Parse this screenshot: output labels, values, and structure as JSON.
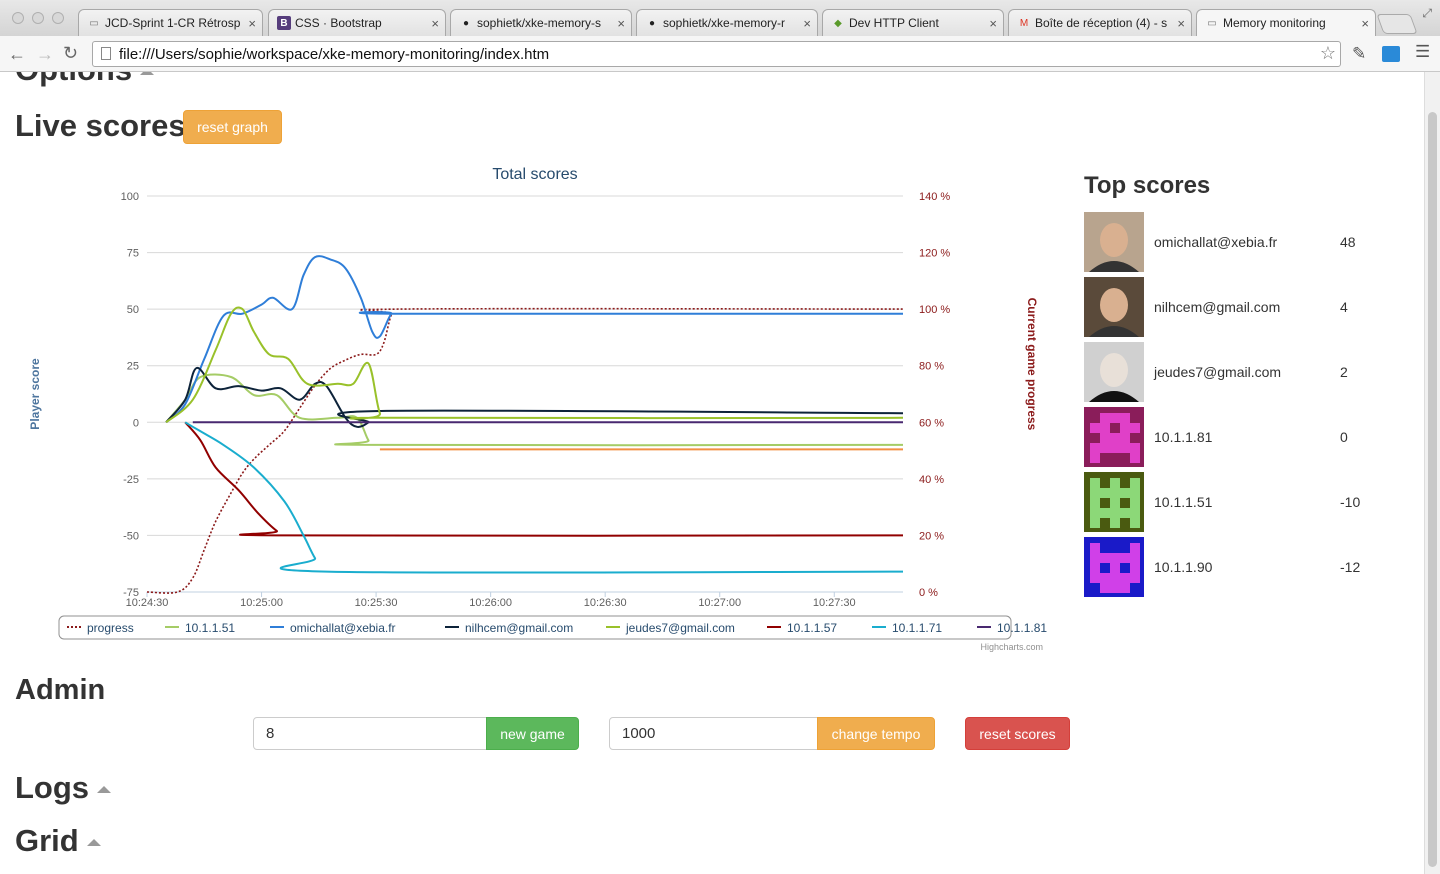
{
  "browser": {
    "tabs": [
      {
        "label": "JCD-Sprint 1-CR Rétrosp",
        "icon": "document-icon"
      },
      {
        "label": "CSS · Bootstrap",
        "icon": "bootstrap-icon"
      },
      {
        "label": "sophietk/xke-memory-s",
        "icon": "github-icon"
      },
      {
        "label": "sophietk/xke-memory-r",
        "icon": "github-icon"
      },
      {
        "label": "Dev HTTP Client",
        "icon": "http-client-icon"
      },
      {
        "label": "Boîte de réception (4) - s",
        "icon": "gmail-icon"
      },
      {
        "label": "Memory monitoring",
        "icon": "document-icon"
      }
    ],
    "url": "file:///Users/sophie/workspace/xke-memory-monitoring/index.htm"
  },
  "sections": {
    "options": "Options",
    "live_scores": "Live scores",
    "reset_graph": "reset graph",
    "top_scores": "Top scores",
    "admin": "Admin",
    "logs": "Logs",
    "grid": "Grid"
  },
  "admin": {
    "pairs_value": "8",
    "new_game": "new game",
    "tempo_value": "1000",
    "change_tempo": "change tempo",
    "reset_scores": "reset scores"
  },
  "top_scores": [
    {
      "email": "omichallat@xebia.fr",
      "score": "48",
      "avatar": "photo-avatar-1",
      "color": "#b8a48e"
    },
    {
      "email": "nilhcem@gmail.com",
      "score": "4",
      "avatar": "photo-avatar-2",
      "color": "#5a4a3a"
    },
    {
      "email": "jeudes7@gmail.com",
      "score": "2",
      "avatar": "photo-avatar-3",
      "color": "#d0d0d0"
    },
    {
      "email": "10.1.1.81",
      "score": "0",
      "avatar": "identicon",
      "color": "#8a1d5a",
      "fg": "#e040c8"
    },
    {
      "email": "10.1.1.51",
      "score": "-10",
      "avatar": "identicon",
      "color": "#4a5a10",
      "fg": "#8cd878"
    },
    {
      "email": "10.1.1.90",
      "score": "-12",
      "avatar": "identicon",
      "color": "#1a1ac8",
      "fg": "#d040e8"
    }
  ],
  "chart_data": {
    "type": "line",
    "title": "Total scores",
    "ylabel": "Player score",
    "ylabel_right": "Current game progress",
    "ylim": [
      -75,
      100
    ],
    "y_ticks": [
      "100",
      "75",
      "50",
      "25",
      "0",
      "-25",
      "-50",
      "-75"
    ],
    "y_right_ticks": [
      "140 %",
      "120 %",
      "100 %",
      "80 %",
      "60 %",
      "40 %",
      "20 %",
      "0 %"
    ],
    "ylim_right": [
      0,
      140
    ],
    "x_ticks": [
      "10:24:30",
      "10:25:00",
      "10:25:30",
      "10:26:00",
      "10:26:30",
      "10:27:00",
      "10:27:30"
    ],
    "xlim_seconds": [
      0,
      198
    ],
    "credits": "Highcharts.com",
    "grid": true,
    "legend_position": "bottom",
    "series": [
      {
        "name": "progress",
        "axis": "right",
        "dashed": true,
        "color": "#8b1a1a",
        "points": [
          [
            0,
            0
          ],
          [
            8,
            0
          ],
          [
            12,
            5
          ],
          [
            15,
            15
          ],
          [
            18,
            25
          ],
          [
            22,
            35
          ],
          [
            25,
            42
          ],
          [
            28,
            47
          ],
          [
            32,
            52
          ],
          [
            36,
            57
          ],
          [
            40,
            65
          ],
          [
            44,
            73
          ],
          [
            48,
            79
          ],
          [
            52,
            82
          ],
          [
            56,
            84
          ],
          [
            60,
            84
          ],
          [
            62,
            88
          ],
          [
            64,
            98
          ],
          [
            66,
            100
          ],
          [
            198,
            100
          ]
        ]
      },
      {
        "name": "10.1.1.51",
        "color": "#8bbc21",
        "points": [
          [
            5,
            0
          ],
          [
            10,
            10
          ],
          [
            14,
            20
          ],
          [
            22,
            20
          ],
          [
            28,
            12
          ],
          [
            34,
            12
          ],
          [
            40,
            2
          ],
          [
            50,
            2
          ],
          [
            55,
            2
          ],
          [
            58,
            -8
          ],
          [
            60,
            -10
          ],
          [
            198,
            -10
          ]
        ]
      },
      {
        "name": "omichallat@xebia.fr",
        "color": "#2f7ed8",
        "points": [
          [
            5,
            0
          ],
          [
            10,
            8
          ],
          [
            15,
            28
          ],
          [
            20,
            47
          ],
          [
            25,
            48
          ],
          [
            30,
            52
          ],
          [
            33,
            55
          ],
          [
            38,
            50
          ],
          [
            41,
            65
          ],
          [
            44,
            73
          ],
          [
            48,
            72
          ],
          [
            52,
            68
          ],
          [
            56,
            55
          ],
          [
            59,
            40
          ],
          [
            61,
            38
          ],
          [
            64,
            48
          ],
          [
            66,
            48
          ],
          [
            198,
            48
          ]
        ]
      },
      {
        "name": "nilhcem@gmail.com",
        "color": "#0d233a",
        "points": [
          [
            5,
            0
          ],
          [
            10,
            10
          ],
          [
            13,
            24
          ],
          [
            18,
            15
          ],
          [
            24,
            16
          ],
          [
            30,
            14
          ],
          [
            35,
            15
          ],
          [
            40,
            10
          ],
          [
            44,
            17
          ],
          [
            47,
            16
          ],
          [
            52,
            2
          ],
          [
            55,
            -2
          ],
          [
            58,
            0
          ],
          [
            61,
            5
          ],
          [
            198,
            4
          ]
        ]
      },
      {
        "name": "jeudes7@gmail.com",
        "color": "#8bbc21",
        "bright": true,
        "points": [
          [
            5,
            0
          ],
          [
            12,
            10
          ],
          [
            18,
            32
          ],
          [
            22,
            48
          ],
          [
            25,
            50
          ],
          [
            28,
            40
          ],
          [
            32,
            30
          ],
          [
            37,
            28
          ],
          [
            42,
            17
          ],
          [
            50,
            17
          ],
          [
            54,
            17
          ],
          [
            58,
            26
          ],
          [
            61,
            4
          ],
          [
            64,
            2
          ],
          [
            198,
            2
          ]
        ]
      },
      {
        "name": "10.1.1.57",
        "color": "#910000",
        "points": [
          [
            10,
            0
          ],
          [
            14,
            -8
          ],
          [
            18,
            -20
          ],
          [
            24,
            -30
          ],
          [
            29,
            -40
          ],
          [
            34,
            -48
          ],
          [
            37,
            -50
          ],
          [
            198,
            -50
          ]
        ]
      },
      {
        "name": "10.1.1.71",
        "color": "#1aadce",
        "points": [
          [
            10,
            0
          ],
          [
            14,
            -4
          ],
          [
            20,
            -10
          ],
          [
            28,
            -20
          ],
          [
            36,
            -35
          ],
          [
            41,
            -50
          ],
          [
            44,
            -60
          ],
          [
            47,
            -66
          ],
          [
            198,
            -66
          ]
        ]
      },
      {
        "name": "10.1.1.81",
        "color": "#492970",
        "points": [
          [
            12,
            0
          ],
          [
            198,
            0
          ]
        ]
      },
      {
        "name": "10.1.1.90",
        "color": "#f28f43",
        "points": [
          [
            61,
            -12
          ],
          [
            198,
            -12
          ]
        ]
      }
    ]
  }
}
